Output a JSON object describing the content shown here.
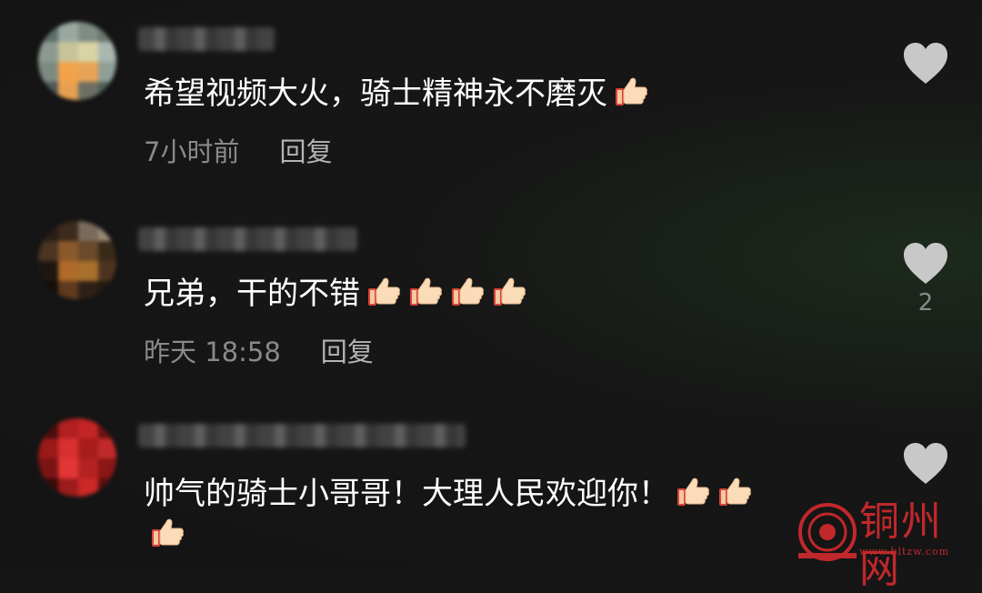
{
  "comments": [
    {
      "text": "希望视频大火，骑士精神永不磨灭",
      "thumbs": 1,
      "time": "7小时前",
      "reply": "回复",
      "likes": ""
    },
    {
      "text": "兄弟，干的不错",
      "thumbs": 4,
      "time": "昨天 18:58",
      "reply": "回复",
      "likes": "2"
    },
    {
      "text": "帅气的骑士小哥哥！大理人民欢迎你！",
      "thumbs": 3,
      "time": "",
      "reply": "",
      "likes": ""
    }
  ],
  "icons": {
    "like": "heart-icon",
    "emoji": "thumbs-up-icon"
  },
  "colors": {
    "text": "#ffffff",
    "meta": "#8a8a8a",
    "heart": "#c8c8c8",
    "watermark": "#c0282b"
  },
  "watermark": {
    "name": "铜州网",
    "url": "www.bltzw.com"
  }
}
